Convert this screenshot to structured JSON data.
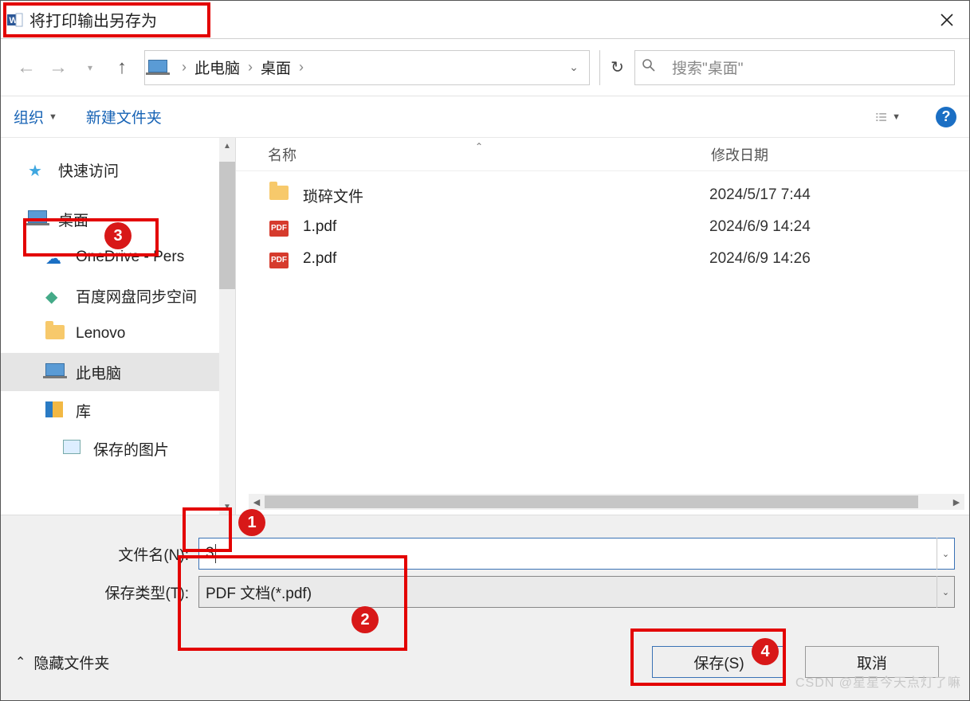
{
  "title": "将打印输出另存为",
  "breadcrumb": {
    "seg1": "此电脑",
    "seg2": "桌面"
  },
  "search": {
    "placeholder": "搜索\"桌面\""
  },
  "toolbar": {
    "organize": "组织",
    "new_folder": "新建文件夹"
  },
  "tree": {
    "items": [
      {
        "label": "快速访问",
        "icon": "star"
      },
      {
        "label": "桌面",
        "icon": "laptop"
      },
      {
        "label": "OneDrive - Pers",
        "icon": "cloud"
      },
      {
        "label": "百度网盘同步空间",
        "icon": "disk",
        "truncated": true
      },
      {
        "label": "Lenovo",
        "icon": "folder-user"
      },
      {
        "label": "此电脑",
        "icon": "laptop",
        "selected": true
      },
      {
        "label": "库",
        "icon": "lib"
      },
      {
        "label": "保存的图片",
        "icon": "pic"
      }
    ]
  },
  "files": {
    "hdr_name": "名称",
    "hdr_date": "修改日期",
    "rows": [
      {
        "name": "琐碎文件",
        "date": "2024/5/17 7:44",
        "icon": "folder"
      },
      {
        "name": "1.pdf",
        "date": "2024/6/9 14:24",
        "icon": "pdf"
      },
      {
        "name": "2.pdf",
        "date": "2024/6/9 14:26",
        "icon": "pdf"
      }
    ]
  },
  "form": {
    "filename_label": "文件名(N):",
    "filename_value": "3",
    "filetype_label": "保存类型(T):",
    "filetype_value": "PDF 文档(*.pdf)",
    "hide_folders": "隐藏文件夹",
    "save": "保存(S)",
    "cancel": "取消"
  },
  "annotations": {
    "b1": "1",
    "b2": "2",
    "b3": "3",
    "b4": "4"
  },
  "watermark": "CSDN @星星今天点灯了嘛"
}
